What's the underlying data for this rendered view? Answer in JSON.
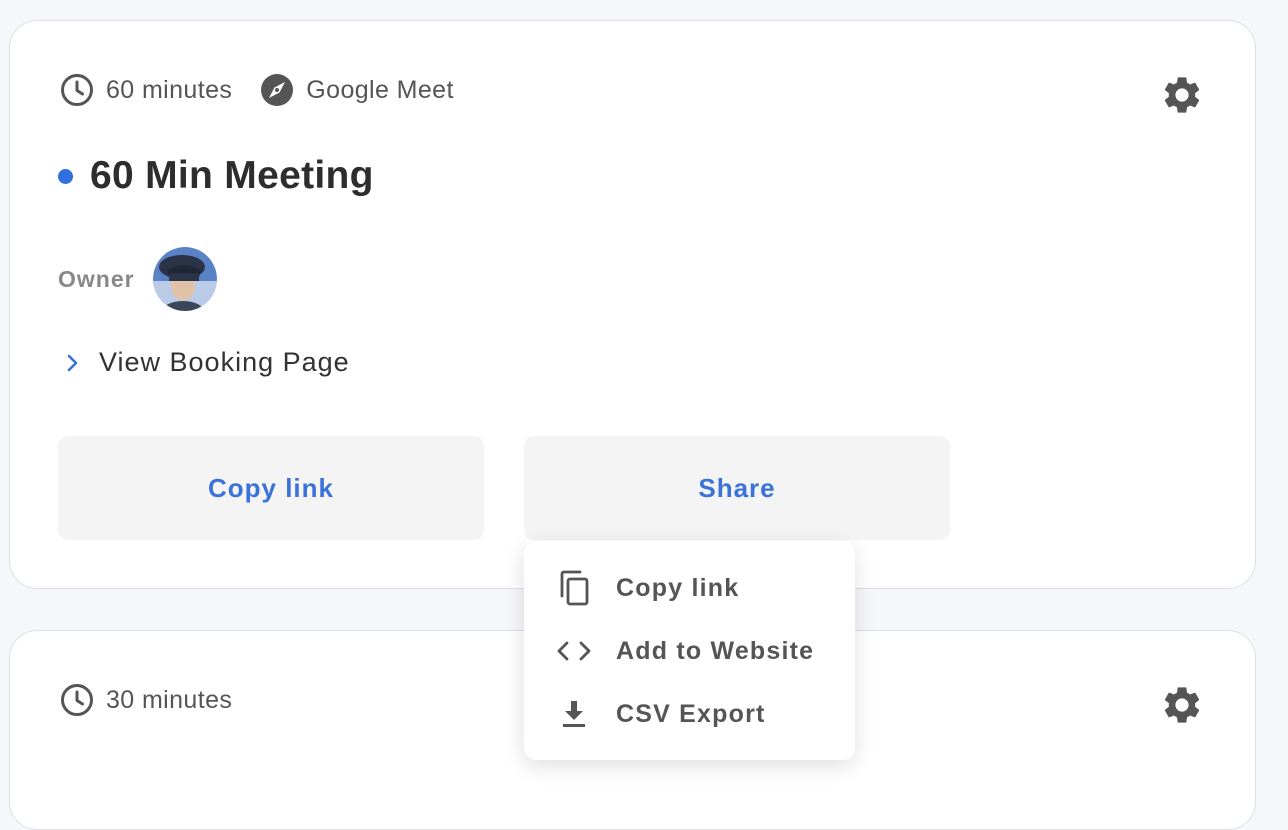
{
  "events": [
    {
      "duration": "60 minutes",
      "location": "Google Meet",
      "title": "60 Min Meeting",
      "owner_label": "Owner",
      "view_link": "View Booking Page",
      "copy_link_label": "Copy link",
      "share_label": "Share",
      "accent_color": "#2f6fdf"
    },
    {
      "duration": "30 minutes"
    }
  ],
  "share_menu": {
    "items": [
      {
        "label": "Copy link",
        "icon": "copy-icon"
      },
      {
        "label": "Add to Website",
        "icon": "code-icon"
      },
      {
        "label": "CSV Export",
        "icon": "download-icon"
      }
    ]
  },
  "colors": {
    "link_blue": "#3a72d9",
    "button_bg": "#f4f4f4",
    "card_border": "#dcdfe6",
    "page_bg": "#f6f7fb"
  }
}
